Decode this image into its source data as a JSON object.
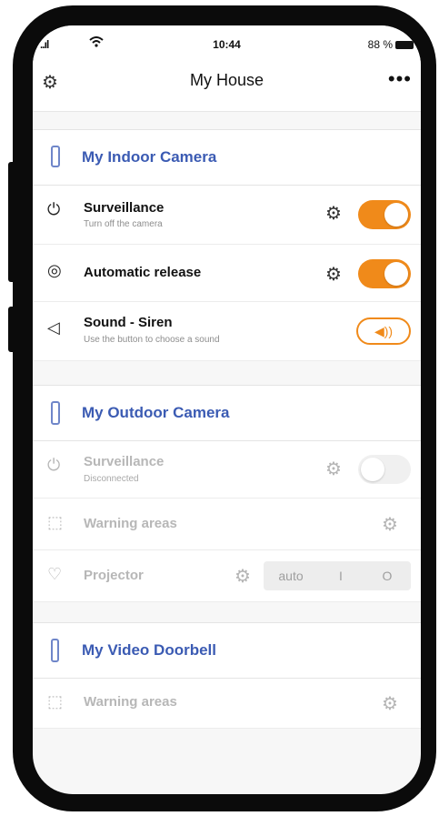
{
  "status": {
    "signal": "..ıl",
    "time": "10:44",
    "battery": "88 %"
  },
  "header": {
    "title": "My House",
    "settings_icon": "gear-icon",
    "more_icon": "more-icon",
    "more_glyph": "•••"
  },
  "indoor": {
    "title": "My Indoor Camera",
    "rows": {
      "surveillance": {
        "label": "Surveillance",
        "sub": "Turn off the camera",
        "toggle": "on"
      },
      "auto_release": {
        "label": "Automatic release",
        "toggle": "on"
      },
      "sound": {
        "label": "Sound - Siren",
        "sub": "Use the button to choose a sound"
      }
    }
  },
  "outdoor": {
    "title": "My Outdoor Camera",
    "rows": {
      "surveillance": {
        "label": "Surveillance",
        "sub": "Disconnected",
        "toggle": "off"
      },
      "warning": {
        "label": "Warning areas"
      },
      "projector": {
        "label": "Projector",
        "modes": [
          "auto",
          "I",
          "O"
        ]
      }
    }
  },
  "doorbell": {
    "title": "My Video Doorbell",
    "rows": {
      "warning": {
        "label": "Warning areas"
      }
    }
  },
  "colors": {
    "accent": "#f08a1a",
    "title_blue": "#3b5bb3",
    "icon_blue": "#6f86c9"
  }
}
